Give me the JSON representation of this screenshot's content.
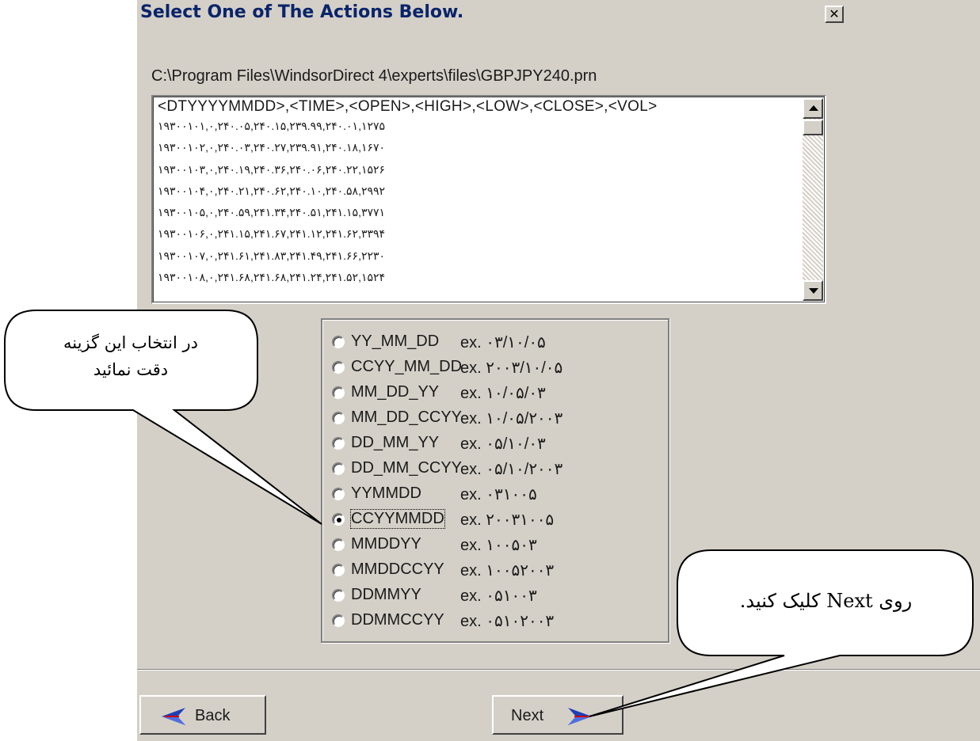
{
  "dialog": {
    "title": "Select One of The Actions Below.",
    "close_glyph": "✕"
  },
  "file": {
    "path": "C:\\Program Files\\WindsorDirect 4\\experts\\files\\GBPJPY240.prn",
    "header": "<DTYYYYMMDD>,<TIME>,<OPEN>,<HIGH>,<LOW>,<CLOSE>,<VOL>",
    "rows": [
      "۱۹۳۰۰۱۰۱,۰,۲۴۰.۰۵,۲۴۰.۱۵,۲۳۹.۹۹,۲۴۰.۰۱,۱۲۷۵",
      "۱۹۳۰۰۱۰۲,۰,۲۴۰.۰۳,۲۴۰.۲۷,۲۳۹.۹۱,۲۴۰.۱۸,۱۶۷۰",
      "۱۹۳۰۰۱۰۳,۰,۲۴۰.۱۹,۲۴۰.۳۶,۲۴۰.۰۶,۲۴۰.۲۲,۱۵۲۶",
      "۱۹۳۰۰۱۰۴,۰,۲۴۰.۲۱,۲۴۰.۶۲,۲۴۰.۱۰,۲۴۰.۵۸,۲۹۹۲",
      "۱۹۳۰۰۱۰۵,۰,۲۴۰.۵۹,۲۴۱.۳۴,۲۴۰.۵۱,۲۴۱.۱۵,۳۷۷۱",
      "۱۹۳۰۰۱۰۶,۰,۲۴۱.۱۵,۲۴۱.۶۷,۲۴۱.۱۲,۲۴۱.۶۲,۳۳۹۴",
      "۱۹۳۰۰۱۰۷,۰,۲۴۱.۶۱,۲۴۱.۸۳,۲۴۱.۴۹,۲۴۱.۶۶,۲۲۳۰",
      "۱۹۳۰۰۱۰۸,۰,۲۴۱.۶۸,۲۴۱.۶۸,۲۴۱.۲۴,۲۴۱.۵۲,۱۵۲۴"
    ]
  },
  "date_formats": [
    {
      "label": "YY_MM_DD",
      "example": "ex. ۰۳/۱۰/۰۵",
      "selected": false
    },
    {
      "label": "CCYY_MM_DD",
      "example": "ex. ۲۰۰۳/۱۰/۰۵",
      "selected": false
    },
    {
      "label": "MM_DD_YY",
      "example": "ex. ۱۰/۰۵/۰۳",
      "selected": false
    },
    {
      "label": "MM_DD_CCYY",
      "example": "ex. ۱۰/۰۵/۲۰۰۳",
      "selected": false
    },
    {
      "label": "DD_MM_YY",
      "example": "ex. ۰۵/۱۰/۰۳",
      "selected": false
    },
    {
      "label": "DD_MM_CCYY",
      "example": "ex. ۰۵/۱۰/۲۰۰۳",
      "selected": false
    },
    {
      "label": "YYMMDD",
      "example": "ex. ۰۳۱۰۰۵",
      "selected": false
    },
    {
      "label": "CCYYMMDD",
      "example": "ex. ۲۰۰۳۱۰۰۵",
      "selected": true
    },
    {
      "label": "MMDDYY",
      "example": "ex. ۱۰۰۵۰۳",
      "selected": false
    },
    {
      "label": "MMDDCCYY",
      "example": "ex. ۱۰۰۵۲۰۰۳",
      "selected": false
    },
    {
      "label": "DDMMYY",
      "example": "ex. ۰۵۱۰۰۳",
      "selected": false
    },
    {
      "label": "DDMMCCYY",
      "example": "ex. ۰۵۱۰۲۰۰۳",
      "selected": false
    }
  ],
  "buttons": {
    "back": "Back",
    "next": "Next"
  },
  "callouts": {
    "format": {
      "line1": "در انتخاب این گزینه",
      "line2": "دقت نمائید"
    },
    "next": "روی  Next کلیک کنید."
  },
  "colors": {
    "dialog_face": "#d4d0c8",
    "title_text": "#0a246a",
    "back_arrow": "#1f3fb5",
    "next_arrow": "#1f3fb5",
    "arrow_accent": "#cc0000"
  },
  "icons": {
    "back": "left-arrow-icon",
    "next": "right-arrow-icon",
    "scroll_up": "scroll-up-arrow-icon",
    "scroll_down": "scroll-down-arrow-icon"
  }
}
